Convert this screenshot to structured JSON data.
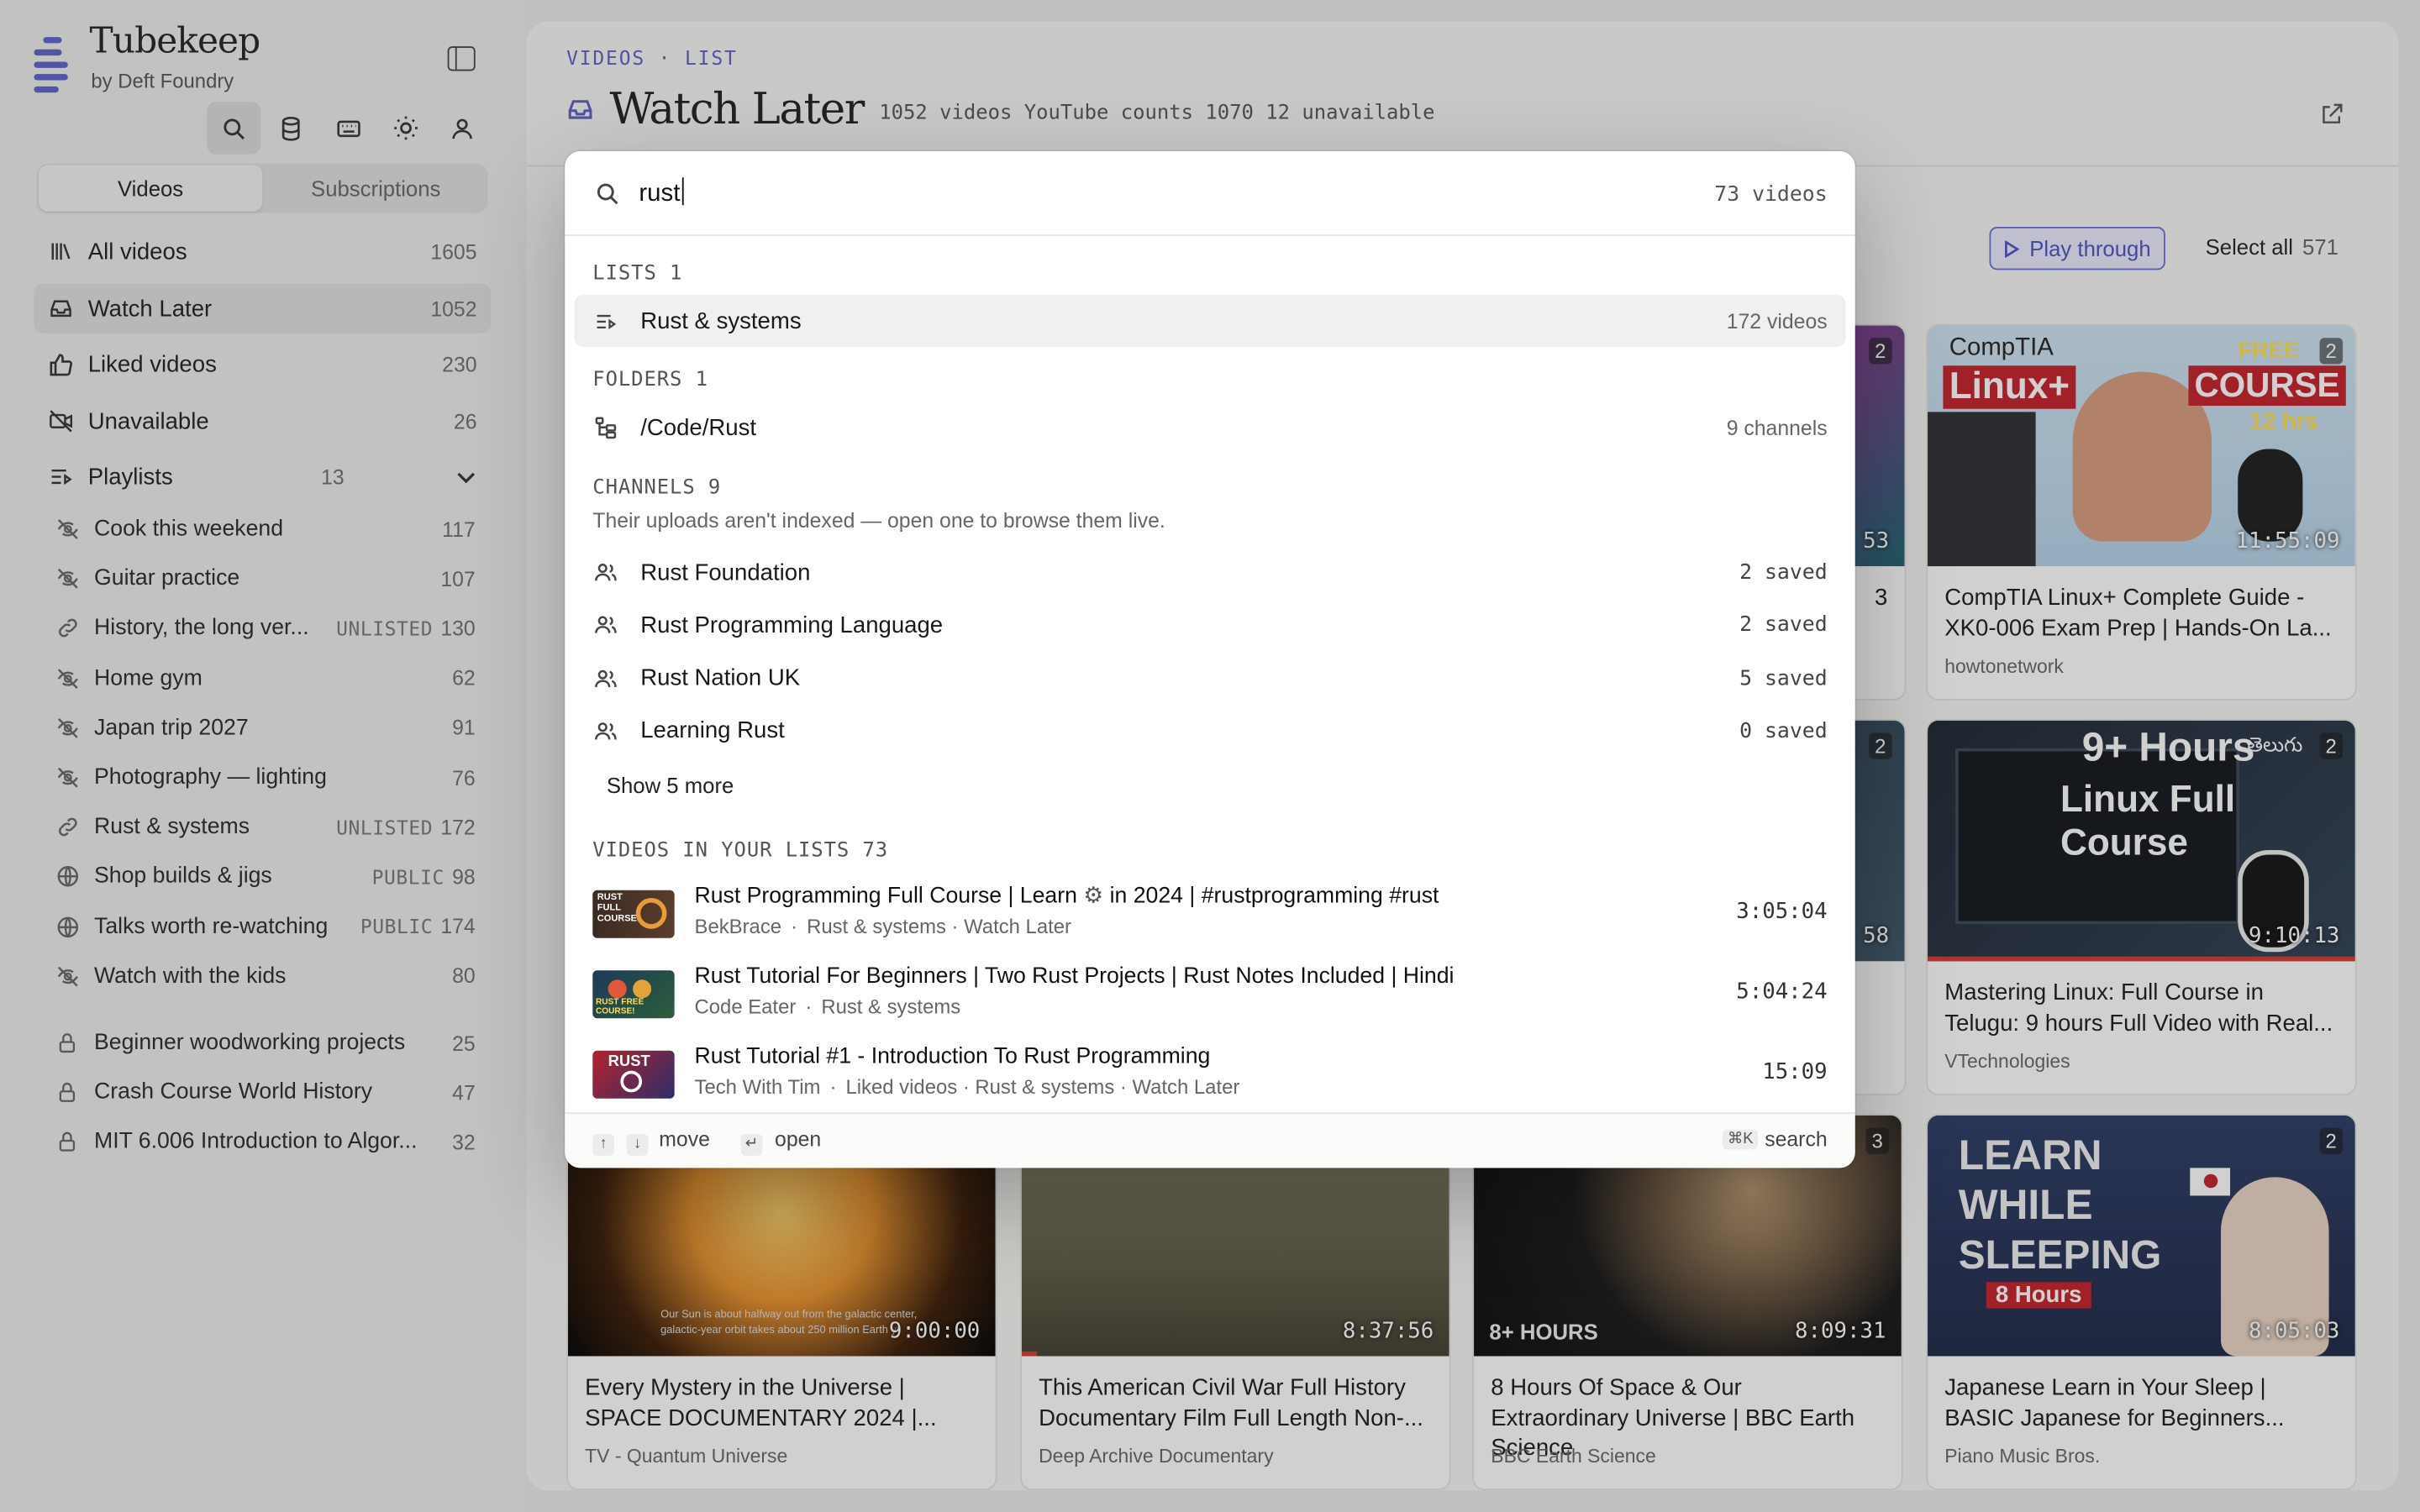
{
  "app": {
    "title": "Tubekeep",
    "subtitle": "by Deft Foundry"
  },
  "sidebar": {
    "tabs": [
      "Videos",
      "Subscriptions"
    ],
    "nav": [
      {
        "label": "All videos",
        "count": "1605"
      },
      {
        "label": "Watch Later",
        "count": "1052"
      },
      {
        "label": "Liked videos",
        "count": "230"
      },
      {
        "label": "Unavailable",
        "count": "26"
      }
    ],
    "playlists_header": {
      "label": "Playlists",
      "count": "13"
    },
    "playlists": [
      {
        "name": "Cook this weekend",
        "tag": "",
        "count": "117"
      },
      {
        "name": "Guitar practice",
        "tag": "",
        "count": "107"
      },
      {
        "name": "History, the long ver...",
        "tag": "UNLISTED",
        "count": "130"
      },
      {
        "name": "Home gym",
        "tag": "",
        "count": "62"
      },
      {
        "name": "Japan trip 2027",
        "tag": "",
        "count": "91"
      },
      {
        "name": "Photography — lighting",
        "tag": "",
        "count": "76"
      },
      {
        "name": "Rust & systems",
        "tag": "UNLISTED",
        "count": "172"
      },
      {
        "name": "Shop builds & jigs",
        "tag": "PUBLIC",
        "count": "98"
      },
      {
        "name": "Talks worth re-watching",
        "tag": "PUBLIC",
        "count": "174"
      },
      {
        "name": "Watch with the kids",
        "tag": "",
        "count": "80"
      }
    ],
    "locked": [
      {
        "name": "Beginner woodworking projects",
        "count": "25"
      },
      {
        "name": "Crash Course World History",
        "count": "47"
      },
      {
        "name": "MIT 6.006 Introduction to Algor...",
        "count": "32"
      }
    ]
  },
  "main": {
    "breadcrumb": "VIDEOS · LIST",
    "title": "Watch Later",
    "meta": "1052 videos YouTube counts 1070 12 unavailable",
    "play_label": "Play through",
    "select_all": "Select all",
    "select_count": "571",
    "partial_labels": {
      "a": "2",
      "b": "53",
      "c": "3",
      "d": "2",
      "e": "58"
    },
    "cards": [
      {
        "title": "CompTIA Linux+ Complete Guide - XK0-006 Exam Prep | Hands-On La...",
        "channel": "howtonetwork",
        "duration": "11:55:09",
        "badge": "2",
        "thumb_text": [
          "CompTIA",
          "Linux+",
          "FREE",
          "COURSE",
          "12 hrs"
        ]
      },
      {
        "title": "Mastering Linux: Full Course in Telugu: 9 hours Full Video with Real...",
        "channel": "VTechnologies",
        "duration": "9:10:13",
        "badge": "2",
        "thumb_text": [
          "9+ Hours",
          "తెలుగు",
          "Linux Full Course"
        ]
      },
      {
        "title": "Every Mystery in the Universe | SPACE DOCUMENTARY 2024 |...",
        "channel": "TV - Quantum Universe",
        "duration": "9:00:00",
        "badge": "",
        "thumb_text": [
          "Our Sun is about halfway out from the galactic center,",
          "galactic-year orbit takes about 250 million Earth y"
        ]
      },
      {
        "title": "This American Civil War Full History Documentary Film Full Length Non-...",
        "channel": "Deep Archive Documentary",
        "duration": "8:37:56",
        "badge": "",
        "thumb_text": []
      },
      {
        "title": "8 Hours Of Space & Our Extraordinary Universe | BBC Earth Science",
        "channel": "BBC Earth Science",
        "duration": "8:09:31",
        "badge": "3",
        "thumb_text": [
          "8+ HOURS"
        ]
      },
      {
        "title": "Japanese Learn in Your Sleep | BASIC Japanese for Beginners...",
        "channel": "Piano Music Bros.",
        "duration": "8:05:03",
        "badge": "2",
        "thumb_text": [
          "LEARN",
          "WHILE",
          "SLEEPING",
          "8 Hours"
        ]
      }
    ]
  },
  "palette": {
    "query": "rust",
    "result_count": "73 videos",
    "lists_header": "LISTS 1",
    "lists": [
      {
        "label": "Rust & systems",
        "meta": "172 videos"
      }
    ],
    "folders_header": "FOLDERS 1",
    "folders": [
      {
        "label": "/Code/Rust",
        "meta": "9 channels"
      }
    ],
    "channels_header": "CHANNELS 9",
    "channels_hint": "Their uploads aren't indexed — open one to browse them live.",
    "channels": [
      {
        "label": "Rust Foundation",
        "meta": "2 saved"
      },
      {
        "label": "Rust Programming Language",
        "meta": "2 saved"
      },
      {
        "label": "Rust Nation UK",
        "meta": "5 saved"
      },
      {
        "label": "Learning Rust",
        "meta": "0 saved"
      }
    ],
    "show_more": "Show 5 more",
    "videos_header": "VIDEOS IN YOUR LISTS 73",
    "videos": [
      {
        "title_a": "Rust Programming Full Course | Learn",
        "title_b": "in 2024 | #rustprogramming #rust",
        "channel": "BekBrace",
        "lists": "Rust & systems · Watch Later",
        "duration": "3:05:04",
        "thumb_text": [
          "RUST",
          "FULL",
          "COURSE"
        ]
      },
      {
        "title_a": "Rust Tutorial For Beginners | Two Rust Projects | Rust Notes Included | Hindi",
        "title_b": "",
        "channel": "Code Eater",
        "lists": "Rust & systems",
        "duration": "5:04:24",
        "thumb_text": [
          "RUST FREE COURSE!"
        ]
      },
      {
        "title_a": "Rust Tutorial #1 - Introduction To Rust Programming",
        "title_b": "",
        "channel": "Tech With Tim",
        "lists": "Liked videos · Rust & systems · Watch Later",
        "duration": "15:09",
        "thumb_text": [
          "RUST"
        ]
      }
    ],
    "footer": {
      "move": "move",
      "open": "open",
      "search_key": "⌘K",
      "search": "search",
      "up": "↑",
      "down": "↓",
      "enter": "↵"
    }
  }
}
